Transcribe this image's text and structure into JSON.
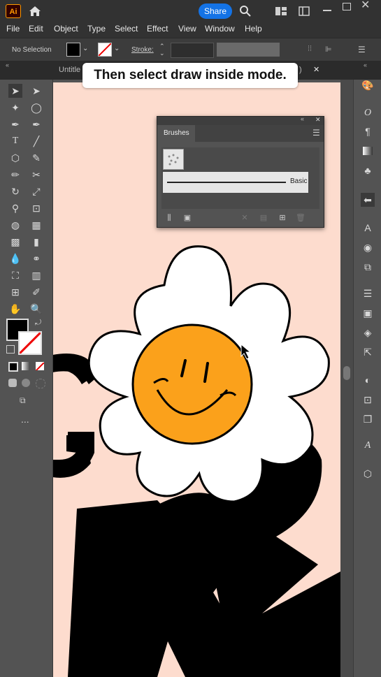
{
  "app": {
    "logo": "Ai",
    "share_label": "Share"
  },
  "menu": [
    "File",
    "Edit",
    "Object",
    "Type",
    "Select",
    "Effect",
    "View",
    "Window",
    "Help"
  ],
  "control_bar": {
    "selection": "No Selection",
    "stroke_label": "Stroke:"
  },
  "document_tab": {
    "title": "Untitle",
    "suffix": ")"
  },
  "tooltip": {
    "text": "Then select draw inside mode."
  },
  "brushes_panel": {
    "title": "Brushes",
    "brush_name": "Basic"
  },
  "toolbar": {
    "more_label": "..."
  },
  "colors": {
    "artboard": "#fddcce",
    "accent": "#1473e6",
    "smiley": "#fba11b",
    "ink": "#000000"
  },
  "icons": [
    "home-icon",
    "search-icon",
    "arrange-icon",
    "window-icon",
    "selection-tool-icon",
    "direct-selection-tool-icon",
    "type-tool-icon",
    "hand-tool-icon",
    "zoom-tool-icon",
    "brushes-icon",
    "layers-icon",
    "libraries-icon"
  ]
}
